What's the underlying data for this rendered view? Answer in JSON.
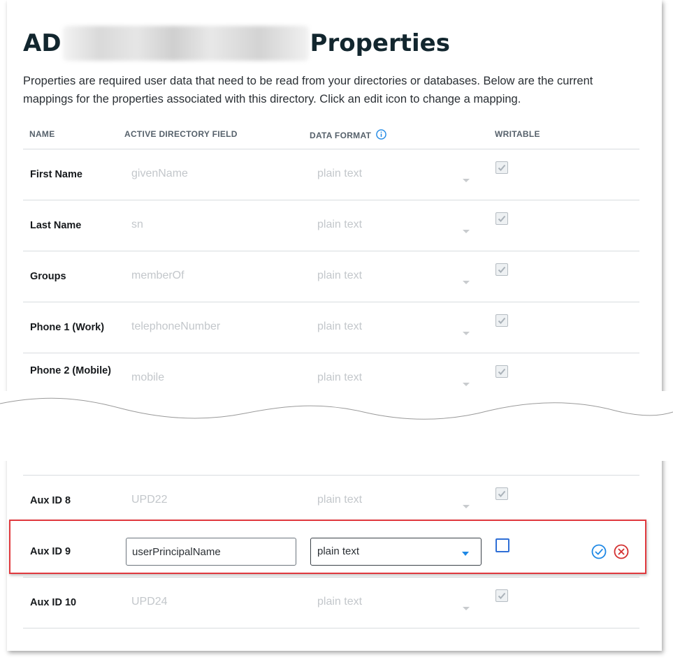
{
  "page": {
    "title_prefix": "AD",
    "title_suffix": "Properties",
    "description": "Properties are required user data that need to be read from your directories or databases.  Below are the current mappings for the properties associated with this directory. Click an edit icon to change a mapping."
  },
  "table": {
    "columns": [
      "NAME",
      "ACTIVE DIRECTORY FIELD",
      "DATA FORMAT",
      "WRITABLE"
    ],
    "rows_top": [
      {
        "name": "First Name",
        "field": "givenName",
        "format": "plain text",
        "writable": true
      },
      {
        "name": "Last Name",
        "field": "sn",
        "format": "plain text",
        "writable": true
      },
      {
        "name": "Groups",
        "field": "memberOf",
        "format": "plain text",
        "writable": true
      },
      {
        "name": "Phone 1 (Work)",
        "field": "telephoneNumber",
        "format": "plain text",
        "writable": true
      },
      {
        "name": "Phone 2 (Mobile)",
        "field": "mobile",
        "format": "plain text",
        "writable": true
      }
    ],
    "rows_bottom": [
      {
        "name": "Aux ID 8",
        "field": "UPD22",
        "format": "plain text",
        "writable": true
      },
      {
        "name": "Aux ID 9",
        "field": "userPrincipalName",
        "format": "plain text",
        "writable": false,
        "editing": true
      },
      {
        "name": "Aux ID 10",
        "field": "UPD24",
        "format": "plain text",
        "writable": true
      }
    ]
  },
  "icons": {
    "data_format_info": "info-icon",
    "confirm": "check-circle-icon",
    "cancel": "x-circle-icon"
  },
  "colors": {
    "accent_blue": "#1e88e5",
    "highlight_red": "#e0393e",
    "muted_text": "#c3c7cb",
    "title": "#12262e"
  }
}
